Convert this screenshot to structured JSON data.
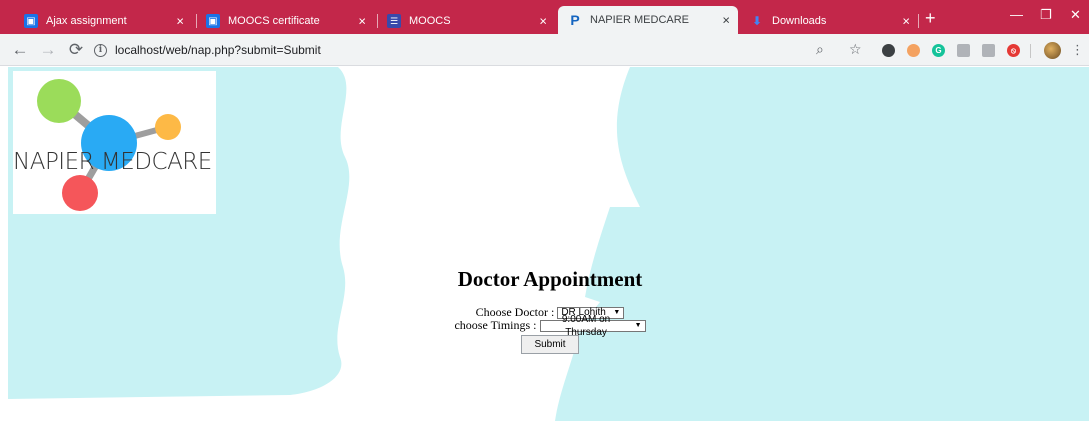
{
  "browser": {
    "tabs": [
      {
        "title": "Ajax assignment",
        "icon": "doc-icon",
        "active": false
      },
      {
        "title": "MOOCS certificate",
        "icon": "doc-icon",
        "active": false
      },
      {
        "title": "MOOCS",
        "icon": "list-icon",
        "active": false
      },
      {
        "title": "NAPIER MEDCARE",
        "icon": "p-icon",
        "active": true
      },
      {
        "title": "Downloads",
        "icon": "download-icon",
        "active": false
      }
    ],
    "close_glyph": "×",
    "new_tab_glyph": "+",
    "url": "localhost/web/nap.php?submit=Submit"
  },
  "logo": {
    "text": "NAPIER MEDCARE",
    "colors": {
      "green": "#9bdc5a",
      "blue": "#29aaf4",
      "orange": "#fdb946",
      "red": "#f5565a",
      "stem": "#9e9e9e"
    }
  },
  "form": {
    "title": "Doctor Appointment",
    "doctor_label": "Choose Doctor :",
    "doctor_value": "DR Lohith",
    "timing_label": "choose Timings :",
    "timing_value": "9:00AM on Thursday",
    "submit_label": "Submit"
  },
  "colors": {
    "tabstrip": "#c3274a",
    "background_shape": "#c8f2f4"
  }
}
